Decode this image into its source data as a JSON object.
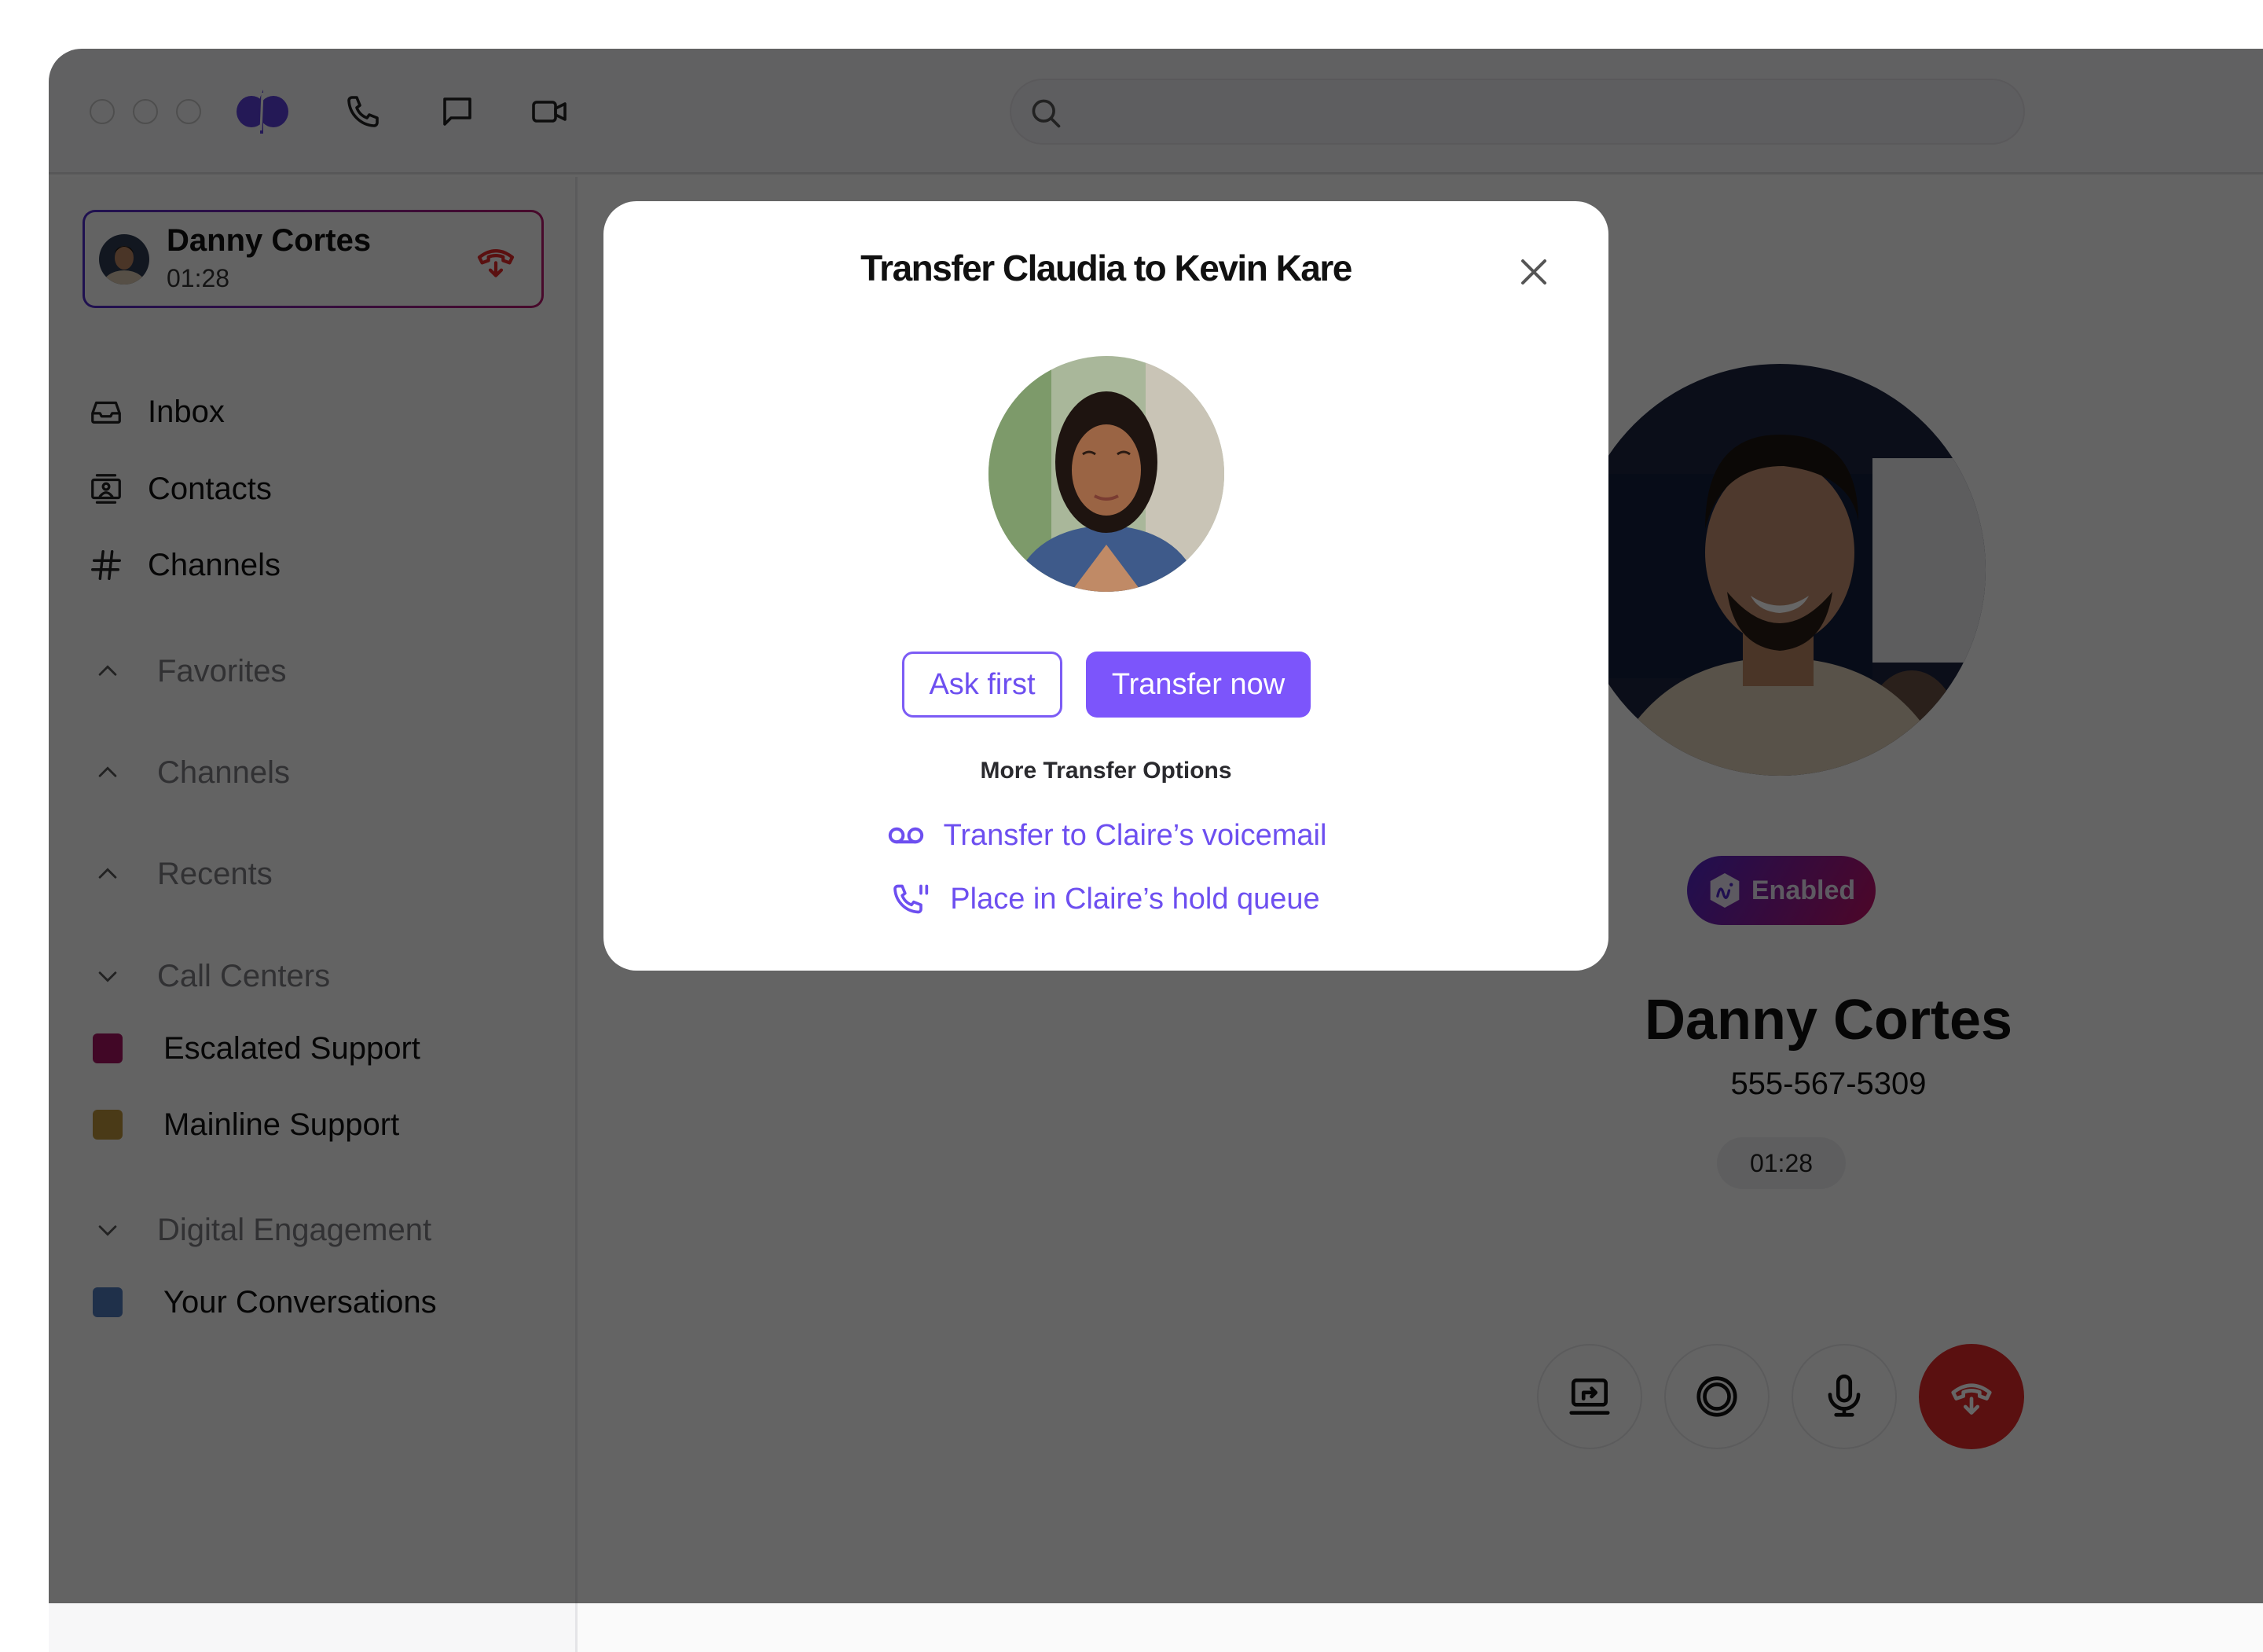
{
  "window": {
    "controls": [
      "close",
      "minimize",
      "zoom"
    ]
  },
  "header": {
    "logo": "dialpad-logo-icon",
    "nav_icons": [
      "phone-icon",
      "chat-icon",
      "video-icon"
    ],
    "search": {
      "value": "",
      "placeholder": "",
      "icon": "search-icon"
    }
  },
  "sidebar": {
    "active_call": {
      "name": "Danny Cortes",
      "duration": "01:28",
      "hangup_icon": "hangup-icon"
    },
    "nav": [
      {
        "label": "Inbox",
        "icon": "inbox-icon"
      },
      {
        "label": "Contacts",
        "icon": "contacts-icon"
      },
      {
        "label": "Channels",
        "icon": "hash-icon"
      }
    ],
    "sections": [
      {
        "label": "Favorites",
        "expanded": false
      },
      {
        "label": "Channels",
        "expanded": false
      },
      {
        "label": "Recents",
        "expanded": false
      },
      {
        "label": "Call Centers",
        "expanded": true
      },
      {
        "label": "Digital Engagement",
        "expanded": true
      }
    ],
    "call_centers": [
      {
        "label": "Escalated Support",
        "color": "#a3135f"
      },
      {
        "label": "Mainline Support",
        "color": "#b8913a"
      }
    ],
    "digital_engagement": [
      {
        "label": "Your Conversations",
        "color": "#4f78b8"
      }
    ]
  },
  "call": {
    "badge_label": "Enabled",
    "badge_icon": "ai-hexagon-icon",
    "name": "Danny Cortes",
    "phone": "555-567-5309",
    "timer": "01:28",
    "controls": [
      {
        "name": "screen-share",
        "icon": "screen-share-icon"
      },
      {
        "name": "record",
        "icon": "record-icon"
      },
      {
        "name": "mute",
        "icon": "microphone-icon"
      },
      {
        "name": "end-call",
        "icon": "hangup-icon"
      }
    ]
  },
  "modal": {
    "title": "Transfer Claudia to Kevin Kare",
    "close_icon": "close-icon",
    "ask_first_label": "Ask first",
    "transfer_now_label": "Transfer now",
    "more_options_title": "More Transfer Options",
    "options": [
      {
        "label": "Transfer to Claire’s voicemail",
        "icon": "voicemail-icon"
      },
      {
        "label": "Place in Claire’s hold queue",
        "icon": "phone-hold-icon"
      }
    ]
  },
  "colors": {
    "accent": "#7c55fb",
    "danger": "#e12a2a",
    "badge_gradient_start": "#5026c8",
    "badge_gradient_end": "#c01064",
    "logo": "#5a3fd6"
  }
}
